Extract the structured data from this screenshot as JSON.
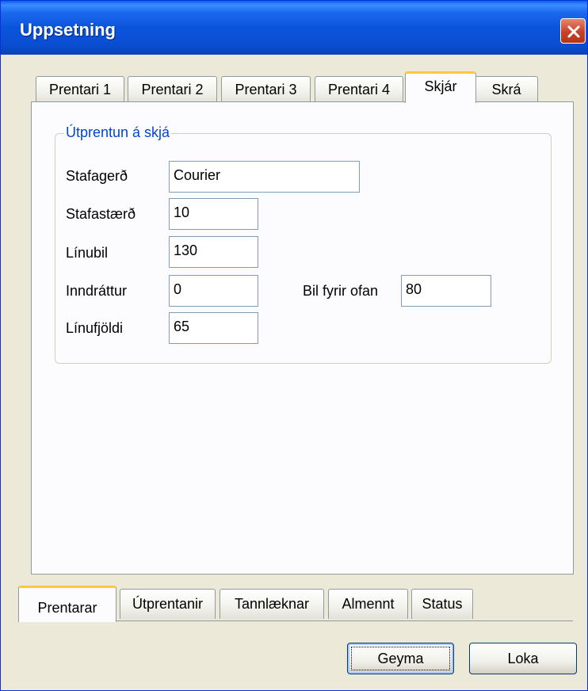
{
  "window": {
    "title": "Uppsetning"
  },
  "top_tabs": [
    "Prentari 1",
    "Prentari 2",
    "Prentari 3",
    "Prentari 4",
    "Skjár",
    "Skrá"
  ],
  "group": {
    "legend": "Útprentun á skjá",
    "fields": {
      "stafagerd": {
        "label": "Stafagerð",
        "value": "Courier"
      },
      "stafastaerd": {
        "label": "Stafastærð",
        "value": "10"
      },
      "linubil": {
        "label": "Línubil",
        "value": "130"
      },
      "inndrattur": {
        "label": "Inndráttur",
        "value": "0"
      },
      "bil_fyrir_ofan": {
        "label": "Bil fyrir ofan",
        "value": "80"
      },
      "linufjoldi": {
        "label": "Línufjöldi",
        "value": "65"
      }
    }
  },
  "bottom_tabs": [
    "Prentarar",
    "Útprentanir",
    "Tannlæknar",
    "Almennt",
    "Status"
  ],
  "buttons": {
    "save": "Geyma",
    "close": "Loka"
  }
}
